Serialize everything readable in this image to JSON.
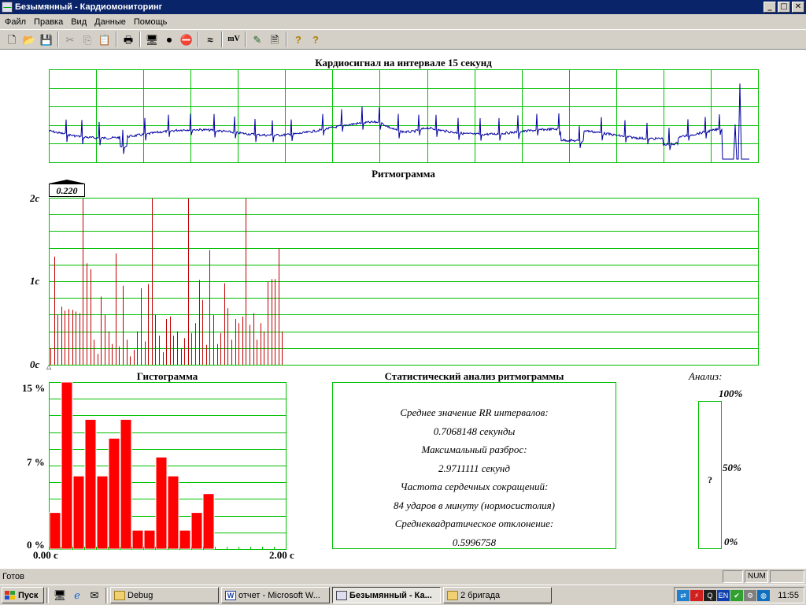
{
  "window": {
    "title": "Безымянный - Кардиомониторинг",
    "buttons": {
      "minimize": "_",
      "maximize": "□",
      "close": "✕"
    }
  },
  "menu": [
    "Файл",
    "Правка",
    "Вид",
    "Данные",
    "Помощь"
  ],
  "toolbar": [
    {
      "icon": "new-file-icon",
      "glyph": "🗋"
    },
    {
      "icon": "open-folder-icon",
      "glyph": "📂"
    },
    {
      "icon": "save-icon",
      "glyph": "💾"
    },
    {
      "icon": "cut-icon",
      "glyph": "✂"
    },
    {
      "icon": "copy-icon",
      "glyph": "⎘"
    },
    {
      "icon": "paste-icon",
      "glyph": "📋"
    },
    {
      "icon": "print-icon",
      "glyph": "🖶"
    },
    {
      "icon": "monitor-icon",
      "glyph": "🖥"
    },
    {
      "icon": "record-icon",
      "glyph": "⏺"
    },
    {
      "icon": "stop-icon",
      "glyph": "⛔"
    },
    {
      "icon": "filter-icon",
      "glyph": "≈"
    },
    {
      "icon": "mv-icon",
      "glyph": "mV"
    },
    {
      "icon": "pen-icon",
      "glyph": "✎"
    },
    {
      "icon": "document-icon",
      "glyph": "🗎"
    },
    {
      "icon": "help-icon",
      "glyph": "?"
    },
    {
      "icon": "context-help-icon",
      "glyph": "?"
    }
  ],
  "colors": {
    "grid": "#00c000",
    "ecg": "#0000a0",
    "rhythm": "#c00000",
    "histogram": "#ff0000"
  },
  "ecg_panel": {
    "title": "Кардиосигнал на интервале 15 секунд"
  },
  "rhythm_panel": {
    "title": "Ритмограмма",
    "marker_value": "0.220",
    "y_labels": [
      "2с",
      "1с",
      "0с"
    ],
    "chart_data": {
      "type": "bar",
      "ylim": [
        0,
        2
      ],
      "values": [
        0.2,
        1.3,
        0.6,
        0.7,
        0.65,
        0.67,
        0.66,
        0.64,
        0.62,
        2.0,
        1.22,
        1.15,
        0.3,
        0.13,
        0.82,
        0.6,
        0.4,
        0.25,
        1.34,
        0.22,
        0.95,
        0.3,
        0.1,
        0.18,
        0.4,
        0.92,
        0.28,
        0.97,
        2.0,
        0.6,
        0.35,
        0.15,
        0.55,
        0.58,
        0.35,
        0.4,
        0.2,
        0.32,
        2.0,
        0.38,
        0.5,
        1.02,
        0.78,
        0.24,
        1.38,
        0.6,
        0.25,
        0.38,
        0.98,
        0.68,
        0.3,
        0.55,
        0.5,
        0.58,
        2.0,
        0.48,
        0.62,
        0.3,
        0.5,
        0.4,
        1.0,
        1.03,
        1.03,
        1.4,
        0.4
      ]
    }
  },
  "histogram_panel": {
    "title": "Гистограмма",
    "y_labels": [
      "15 %",
      "7 %",
      "0 %"
    ],
    "x_labels": [
      "0.00 с",
      "2.00 с"
    ],
    "chart_data": {
      "type": "bar",
      "ylim": [
        0,
        15
      ],
      "values": [
        3.3,
        15.5,
        6.6,
        11.7,
        6.6,
        10.0,
        11.7,
        1.7,
        1.7,
        8.3,
        6.6,
        1.7,
        3.3,
        5.0
      ]
    }
  },
  "stats_panel": {
    "title": "Статистический анализ ритмограммы",
    "lines": [
      "Среднее значение RR интервалов:",
      "0.7068148 секунды",
      "Максимальный разброс:",
      "2.9711111 секунд",
      "Частота сердечных сокращений:",
      "84 ударов в минуту (нормосистолия)",
      "Среднеквадратическое отклонение:",
      "0.5996758"
    ]
  },
  "analysis_panel": {
    "title": "Анализ:",
    "levels": [
      "100%",
      "50%",
      "0%"
    ],
    "value": "?"
  },
  "statusbar": {
    "text": "Готов",
    "indicators": [
      "",
      "NUM",
      ""
    ]
  },
  "taskbar": {
    "start_label": "Пуск",
    "tasks": [
      {
        "label": "Debug",
        "icon": "folder-icon",
        "active": false
      },
      {
        "label": "отчет - Microsoft W...",
        "icon": "word-icon",
        "active": false
      },
      {
        "label": "Безымянный - Ка...",
        "icon": "app-icon",
        "active": true
      },
      {
        "label": "2 бригада",
        "icon": "folder-icon",
        "active": false
      }
    ],
    "tray_lang": "EN",
    "clock": "11:55"
  }
}
